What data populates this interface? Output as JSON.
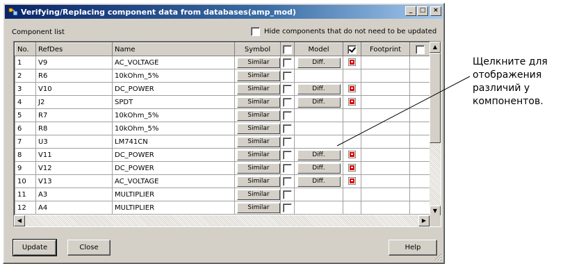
{
  "window": {
    "title": "Verifying/Replacing component data from databases(amp_mod)",
    "controls": {
      "minimize": "_",
      "maximize": "□",
      "close": "×"
    }
  },
  "list": {
    "label": "Component list",
    "hide_checkbox_label": "Hide components that do not need to be updated",
    "hide_checked": false
  },
  "columns": {
    "no": "No.",
    "refdes": "RefDes",
    "name": "Name",
    "symbol": "Symbol",
    "model": "Model",
    "footprint": "Footprint"
  },
  "header_checks": {
    "symbol": false,
    "model": true,
    "footprint": false
  },
  "rows": [
    {
      "no": "1",
      "refdes": "V9",
      "name": "AC_VOLTAGE",
      "symbol": "Similar",
      "model": "Diff.",
      "flag": true
    },
    {
      "no": "2",
      "refdes": "R6",
      "name": "10kOhm_5%",
      "symbol": "Similar",
      "model": "",
      "flag": false
    },
    {
      "no": "3",
      "refdes": "V10",
      "name": "DC_POWER",
      "symbol": "Similar",
      "model": "Diff.",
      "flag": true
    },
    {
      "no": "4",
      "refdes": "J2",
      "name": "SPDT",
      "symbol": "Similar",
      "model": "Diff.",
      "flag": true
    },
    {
      "no": "5",
      "refdes": "R7",
      "name": "10kOhm_5%",
      "symbol": "Similar",
      "model": "",
      "flag": false
    },
    {
      "no": "6",
      "refdes": "R8",
      "name": "10kOhm_5%",
      "symbol": "Similar",
      "model": "",
      "flag": false
    },
    {
      "no": "7",
      "refdes": "U3",
      "name": "LM741CN",
      "symbol": "Similar",
      "model": "",
      "flag": false
    },
    {
      "no": "8",
      "refdes": "V11",
      "name": "DC_POWER",
      "symbol": "Similar",
      "model": "Diff.",
      "flag": true
    },
    {
      "no": "9",
      "refdes": "V12",
      "name": "DC_POWER",
      "symbol": "Similar",
      "model": "Diff.",
      "flag": true
    },
    {
      "no": "10",
      "refdes": "V13",
      "name": "AC_VOLTAGE",
      "symbol": "Similar",
      "model": "Diff.",
      "flag": true
    },
    {
      "no": "11",
      "refdes": "A3",
      "name": "MULTIPLIER",
      "symbol": "Similar",
      "model": "",
      "flag": false
    },
    {
      "no": "12",
      "refdes": "A4",
      "name": "MULTIPLIER",
      "symbol": "Similar",
      "model": "",
      "flag": false
    }
  ],
  "buttons": {
    "update": "Update",
    "close": "Close",
    "help": "Help"
  },
  "annotation": {
    "line1": "Щелкните для",
    "line2": "отображения",
    "line3": "различий у",
    "line4": "компонентов."
  },
  "colors": {
    "title_start": "#0a246a",
    "title_end": "#a6caf0",
    "flag_red": "#e00000",
    "face": "#d4d0c8"
  }
}
